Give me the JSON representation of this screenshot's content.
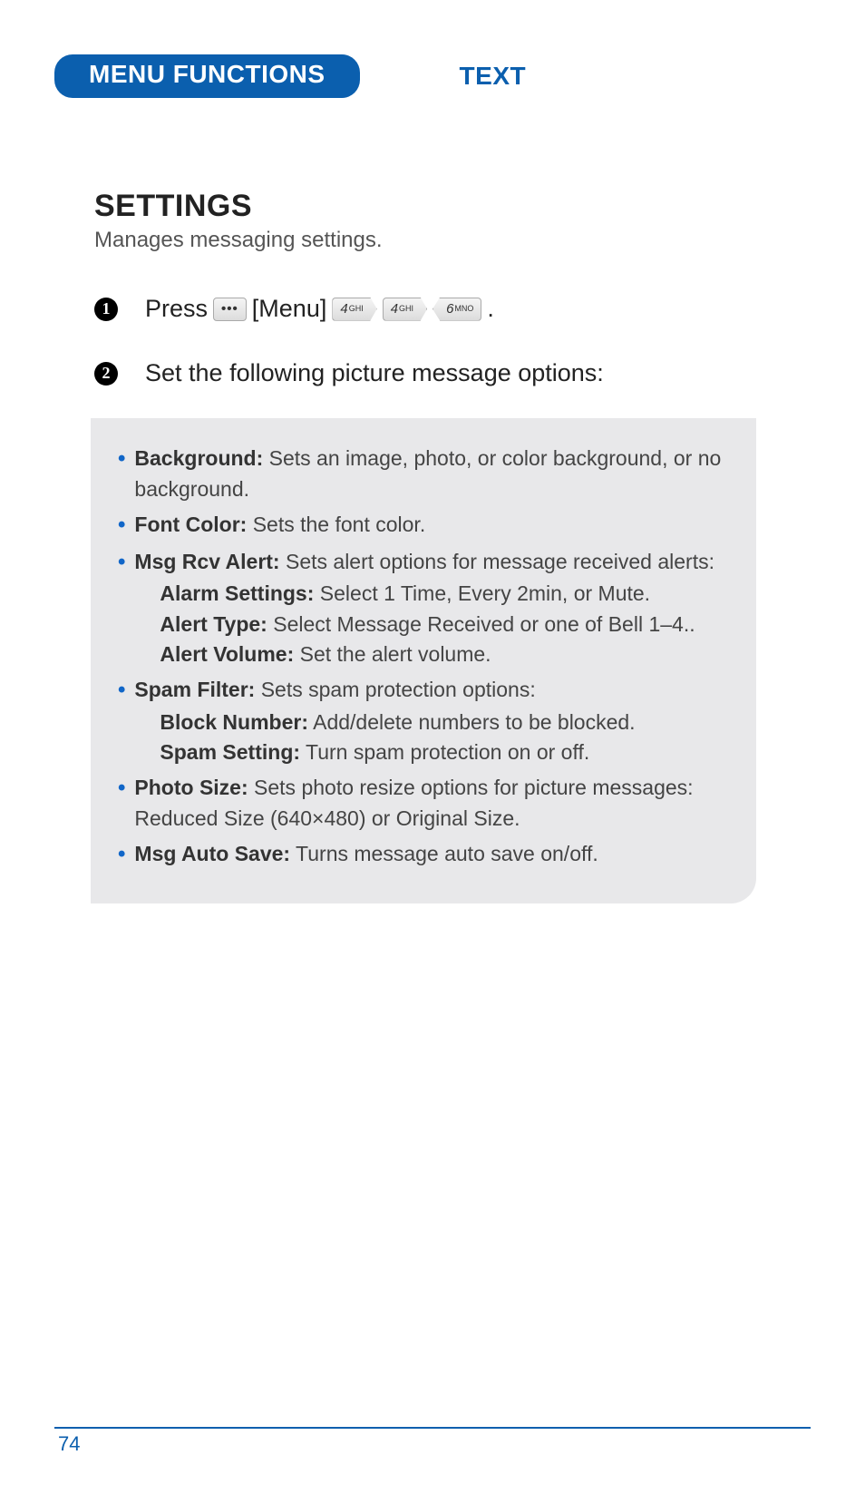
{
  "header": {
    "pill": "MENU FUNCTIONS",
    "section": "TEXT"
  },
  "title": "SETTINGS",
  "subtitle": "Manages messaging settings.",
  "steps": {
    "s1_press": "Press",
    "s1_menu": "[Menu]",
    "s1_end": ".",
    "s2": "Set the following picture message options:"
  },
  "keys": {
    "k4_digit": "4",
    "k4_sub": "GHI",
    "k6_digit": "6",
    "k6_sub": "MNO"
  },
  "options": [
    {
      "label": "Background:",
      "text": " Sets an image, photo, or color background, or no background."
    },
    {
      "label": "Font Color:",
      "text": " Sets the font color."
    },
    {
      "label": "Msg Rcv Alert:",
      "text": " Sets alert options for message received alerts:",
      "sub": [
        {
          "label": "Alarm Settings:",
          "text": " Select 1 Time,  Every 2min, or Mute."
        },
        {
          "label": "Alert Type:",
          "text": " Select Message Received or one of Bell 1–4.."
        },
        {
          "label": "Alert Volume:",
          "text": " Set the alert volume."
        }
      ]
    },
    {
      "label": "Spam Filter:",
      "text": " Sets spam protection options:",
      "sub": [
        {
          "label": "Block Number:",
          "text": " Add/delete numbers to be blocked."
        },
        {
          "label": "Spam Setting:",
          "text": " Turn spam protection on or off."
        }
      ]
    },
    {
      "label": "Photo Size:",
      "text": " Sets photo resize options for picture messages: Reduced Size (640×480) or Original Size."
    },
    {
      "label": "Msg Auto Save:",
      "text": " Turns message auto save on/off."
    }
  ],
  "page_number": "74"
}
